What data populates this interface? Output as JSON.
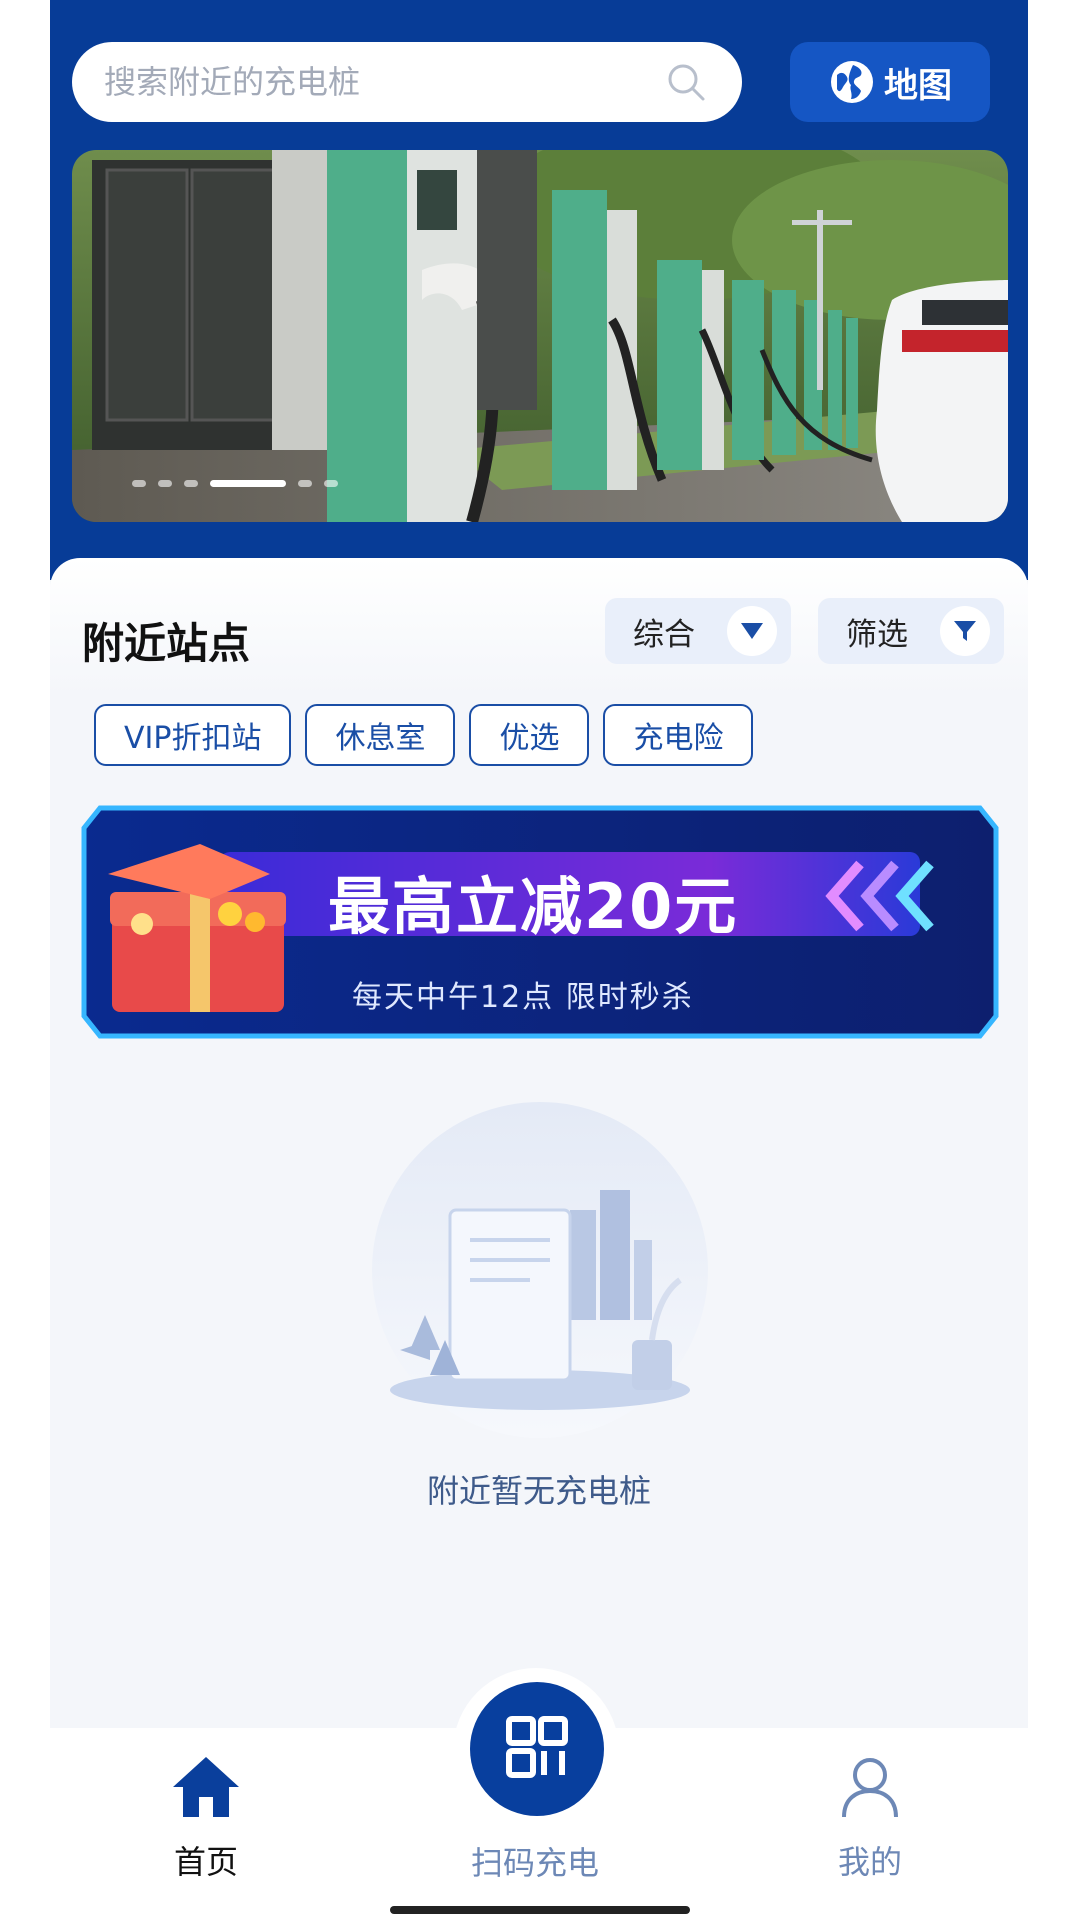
{
  "search": {
    "placeholder": "搜索附近的充电桩"
  },
  "map_button": {
    "label": "地图"
  },
  "banner": {
    "slide_count": 6,
    "active_index": 3
  },
  "nearby": {
    "title": "附近站点",
    "sort_label": "综合",
    "filter_label": "筛选",
    "tags": [
      "VIP折扣站",
      "休息室",
      "优选",
      "充电险"
    ]
  },
  "promo": {
    "title": "最高立减20元",
    "subtitle": "每天中午12点 限时秒杀"
  },
  "empty_state": {
    "message": "附近暂无充电桩"
  },
  "nav": {
    "home": "首页",
    "scan": "扫码充电",
    "mine": "我的"
  },
  "colors": {
    "primary": "#073c97",
    "accent": "#1556c4",
    "background": "#f4f6fa"
  }
}
